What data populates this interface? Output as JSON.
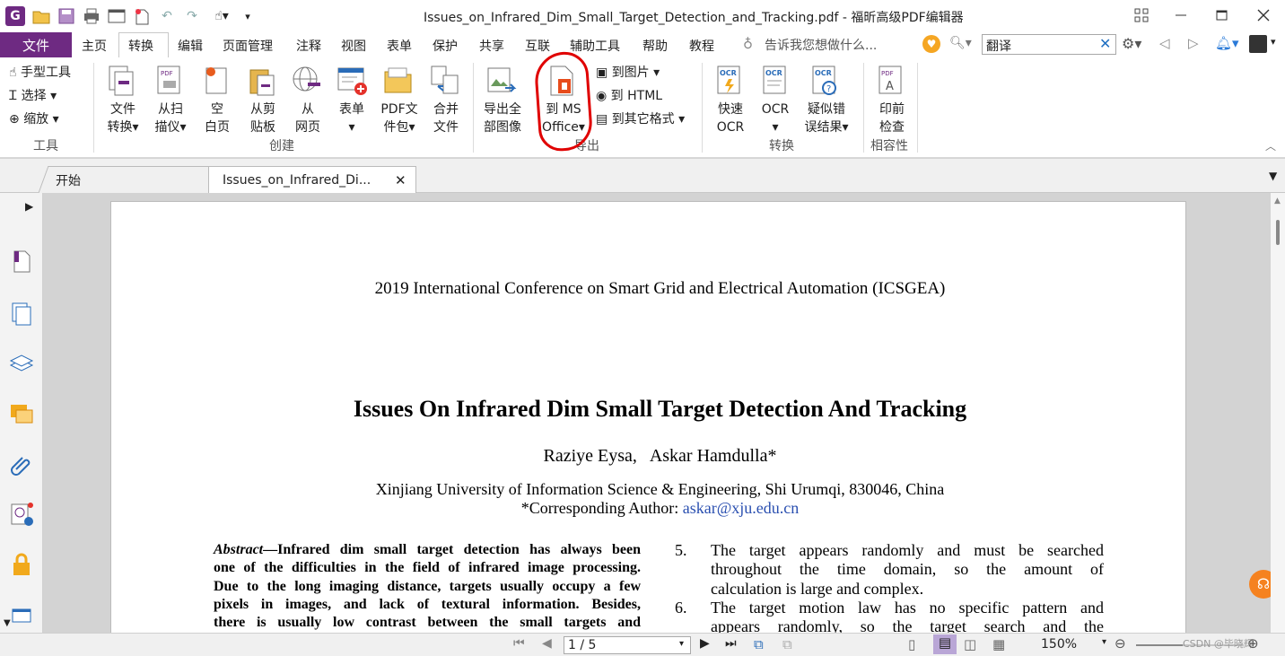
{
  "window": {
    "title": "Issues_on_Infrared_Dim_Small_Target_Detection_and_Tracking.pdf - 福昕高级PDF编辑器"
  },
  "menu": {
    "file": "文件",
    "items": [
      "主页",
      "转换",
      "编辑",
      "页面管理",
      "注释",
      "视图",
      "表单",
      "保护",
      "共享",
      "互联",
      "辅助工具",
      "帮助",
      "教程"
    ],
    "active": "转换",
    "tell_me": "告诉我您想做什么...",
    "search_value": "翻译"
  },
  "ribbon": {
    "tools": {
      "hand": "手型工具",
      "select": "选择",
      "zoom": "缩放",
      "group": "工具"
    },
    "create": {
      "file_convert_1": "文件",
      "file_convert_2": "转换",
      "scan_1": "从扫",
      "scan_2": "描仪",
      "blank_1": "空",
      "blank_2": "白页",
      "clipboard_1": "从剪",
      "clipboard_2": "贴板",
      "web_1": "从",
      "web_2": "网页",
      "form": "表单",
      "pdf_pack_1": "PDF文",
      "pdf_pack_2": "件包",
      "merge_1": "合并",
      "merge_2": "文件",
      "group": "创建"
    },
    "export": {
      "all_images_1": "导出全",
      "all_images_2": "部图像",
      "ms_office_1": "到 MS",
      "ms_office_2": "Office",
      "to_image": "到图片",
      "to_html": "到 HTML",
      "to_other": "到其它格式",
      "group": "导出"
    },
    "convert": {
      "quick_ocr_1": "快速",
      "quick_ocr_2": "OCR",
      "ocr": "OCR",
      "suspect_1": "疑似错",
      "suspect_2": "误结果",
      "group": "转换"
    },
    "compat": {
      "preflight_1": "印前",
      "preflight_2": "检查",
      "group": "相容性"
    }
  },
  "tabs": {
    "start": "开始",
    "doc": "Issues_on_Infrared_Di..."
  },
  "document": {
    "conference": "2019 International Conference on Smart Grid and Electrical Automation (ICSGEA)",
    "title": "Issues On Infrared Dim Small Target Detection And Tracking",
    "authors": "Raziye Eysa,   Askar Hamdulla*",
    "affiliation": "Xinjiang University of Information Science & Engineering, Shi Urumqi, 830046, China",
    "corresponding_prefix": "*Corresponding Author: ",
    "email": "askar@xju.edu.cn",
    "abstract_label": "Abstract",
    "abstract_lines": [
      "—Infrared dim small target detection has always been",
      "one of the difficulties in the field of infrared image processing.",
      "Due to the long imaging distance, targets usually occupy a few",
      "pixels in images, and lack of textural information. Besides,",
      "there is usually low contrast between the small targets and"
    ],
    "list": [
      {
        "num": "5.",
        "lines": [
          "The target appears randomly and must be searched",
          "throughout the time domain, so the amount of",
          "calculation is large and complex."
        ]
      },
      {
        "num": "6.",
        "lines": [
          "The target motion law has no specific pattern and",
          "appears randomly, so the target search and the"
        ]
      }
    ]
  },
  "status": {
    "page": "1 / 5",
    "zoom": "150%",
    "watermark": "CSDN @毕晓辉"
  }
}
